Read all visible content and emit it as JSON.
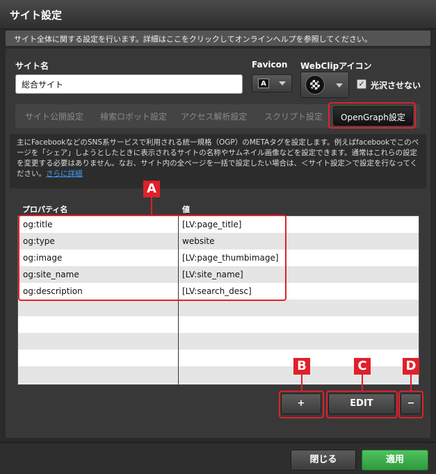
{
  "window": {
    "title": "サイト設定"
  },
  "help_text": "サイト全体に関する設定を行います。詳細はここをクリックしてオンラインヘルプを参照してください。",
  "site_name": {
    "label": "サイト名",
    "value": "総合サイト"
  },
  "favicon": {
    "label": "Favicon",
    "glyph": "A"
  },
  "webclip": {
    "label": "WebClipアイコン"
  },
  "gloss": {
    "label": "光沢させない",
    "checked": "✓"
  },
  "tabs": [
    {
      "label": "サイト公開設定"
    },
    {
      "label": "検索ロボット設定"
    },
    {
      "label": "アクセス解析設定"
    },
    {
      "label": "スクリプト設定"
    },
    {
      "label": "OpenGraph設定"
    }
  ],
  "description": {
    "text": "主にFacebookなどのSNS系サービスで利用される統一規格（OGP）のMETAタグを設定します。例えばfacebookでこのページを「シェア」しようとしたときに表示されるサイトの名称やサムネイル画像などを設定できます。通常はこれらの設定を変更する必要はありません。なお、サイト内の全ページを一括で設定したい場合は、＜サイト設定＞で設定を行なってください。",
    "link": "さらに詳細"
  },
  "table": {
    "headers": {
      "property": "プロパティ名",
      "value": "値"
    },
    "rows": [
      {
        "property": "og:title",
        "value": "[LV:page_title]"
      },
      {
        "property": "og:type",
        "value": "website"
      },
      {
        "property": "og:image",
        "value": "[LV:page_thumbimage]"
      },
      {
        "property": "og:site_name",
        "value": "[LV:site_name]"
      },
      {
        "property": "og:description",
        "value": "[LV:search_desc]"
      }
    ]
  },
  "annotations": {
    "a": "A",
    "b": "B",
    "c": "C",
    "d": "D"
  },
  "buttons": {
    "add": "+",
    "edit": "EDIT",
    "remove": "−",
    "close": "閉じる",
    "apply": "適用"
  },
  "colors": {
    "annotation": "#e0202a",
    "apply": "#3aae4b",
    "link": "#3aa0ff"
  }
}
